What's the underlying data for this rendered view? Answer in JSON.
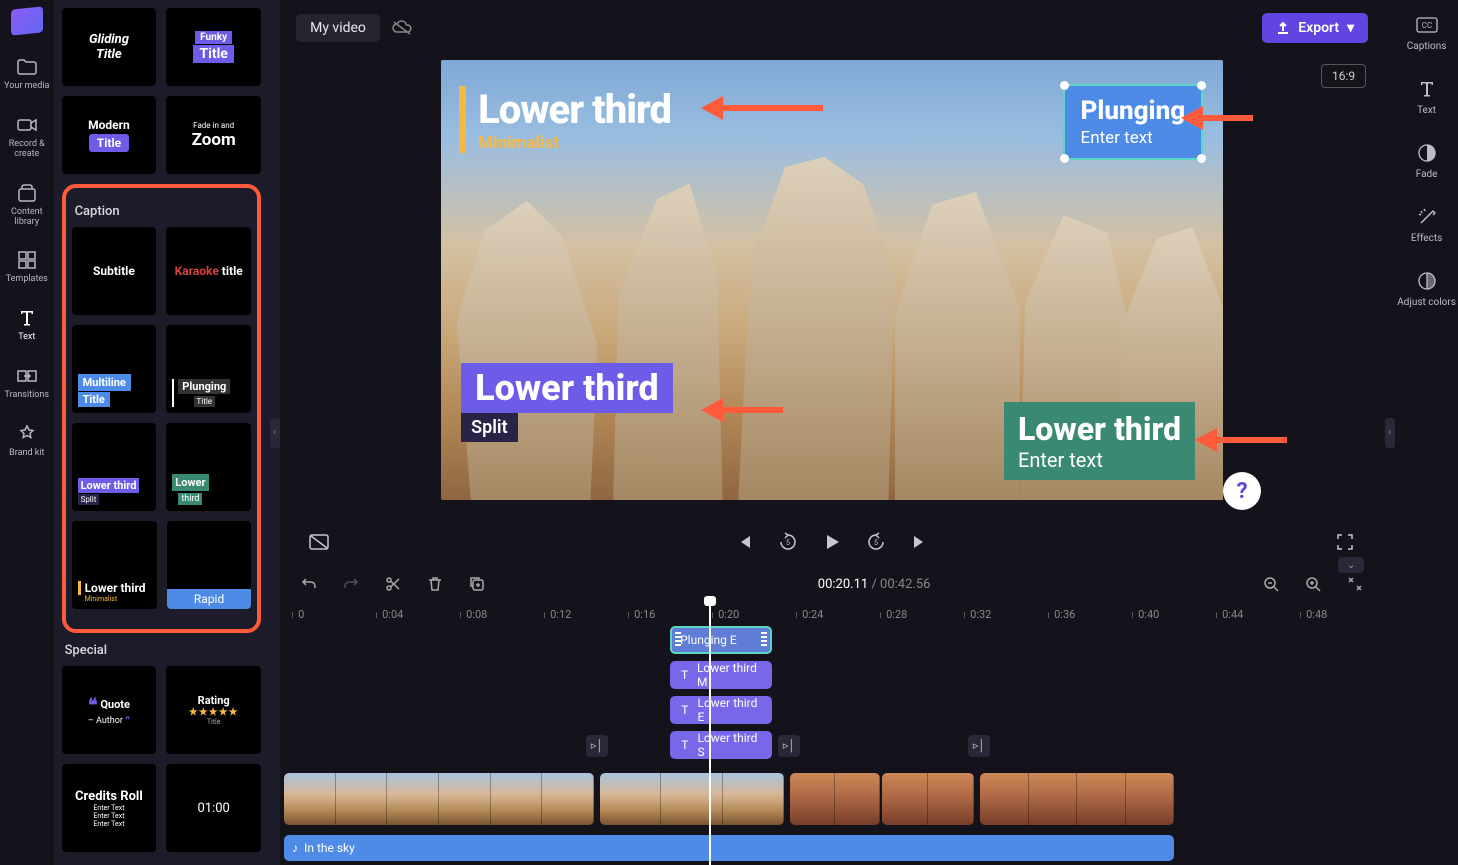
{
  "app": {
    "title": "My video"
  },
  "export": {
    "label": "Export"
  },
  "aspect_ratio": "16:9",
  "far_left_nav": [
    {
      "id": "your-media",
      "label": "Your media",
      "icon": "folder-icon"
    },
    {
      "id": "record-create",
      "label": "Record & create",
      "icon": "camera-icon"
    },
    {
      "id": "content-library",
      "label": "Content library",
      "icon": "library-icon"
    },
    {
      "id": "templates",
      "label": "Templates",
      "icon": "templates-icon"
    },
    {
      "id": "text",
      "label": "Text",
      "icon": "text-icon",
      "active": true
    },
    {
      "id": "transitions",
      "label": "Transitions",
      "icon": "transitions-icon"
    },
    {
      "id": "brand-kit",
      "label": "Brand kit",
      "icon": "brandkit-icon"
    }
  ],
  "text_panel": {
    "top_tiles": [
      {
        "id": "gliding-title",
        "line1": "Gliding",
        "line2": "Title"
      },
      {
        "id": "funky-title",
        "pill": "Funky",
        "main": "Title"
      },
      {
        "id": "modern-title",
        "line1": "Modern",
        "pill": "Title"
      },
      {
        "id": "fade-zoom",
        "line1": "Fade in and",
        "line2": "Zoom"
      }
    ],
    "caption_section": {
      "title": "Caption",
      "tiles": [
        {
          "id": "subtitle",
          "label": "Subtitle"
        },
        {
          "id": "karaoke",
          "colored": "Karaoke",
          "rest": " title"
        },
        {
          "id": "multiline",
          "line1": "Multiline",
          "line2": "Title"
        },
        {
          "id": "plunging",
          "line1": "Plunging",
          "line2": "Title"
        },
        {
          "id": "lt-split",
          "line1": "Lower third",
          "line2": "Split"
        },
        {
          "id": "lt-green",
          "line1": "Lower",
          "line2": "third"
        },
        {
          "id": "lt-minimalist",
          "line1": "Lower third",
          "line2": "Minimalist"
        },
        {
          "id": "rapid",
          "line1": "Rapid"
        }
      ]
    },
    "special_section": {
      "title": "Special",
      "tiles": [
        {
          "id": "quote",
          "line1": "Quote",
          "line2": "– Author"
        },
        {
          "id": "rating",
          "line1": "Rating",
          "sub": "Title"
        },
        {
          "id": "credits",
          "line1": "Credits Roll",
          "sub": "Enter Text"
        },
        {
          "id": "countdown",
          "line1": "01:00"
        }
      ]
    }
  },
  "preview_overlays": {
    "lt_minimalist": {
      "title": "Lower third",
      "subtitle": "Minimalist"
    },
    "plunging": {
      "title": "Plunging",
      "subtitle": "Enter text"
    },
    "lt_split": {
      "title": "Lower third",
      "subtitle": "Split"
    },
    "lt_green": {
      "title": "Lower third",
      "subtitle": "Enter text"
    }
  },
  "playback": {
    "current": "00:20.11",
    "duration": "00:42.56"
  },
  "ruler_ticks": [
    "0",
    "0:04",
    "0:08",
    "0:12",
    "0:16",
    "0:20",
    "0:24",
    "0:28",
    "0:32",
    "0:36",
    "0:40",
    "0:44",
    "0:48"
  ],
  "timeline_clips": {
    "text_tracks": [
      {
        "label": "Plunging E",
        "selected": true
      },
      {
        "label": "Lower third M"
      },
      {
        "label": "Lower third E"
      },
      {
        "label": "Lower third S"
      }
    ],
    "audio": {
      "label": "In the sky"
    }
  },
  "right_panel": [
    {
      "id": "captions",
      "label": "Captions",
      "icon": "cc-icon"
    },
    {
      "id": "text-props",
      "label": "Text",
      "icon": "text-icon"
    },
    {
      "id": "fade",
      "label": "Fade",
      "icon": "fade-icon"
    },
    {
      "id": "effects",
      "label": "Effects",
      "icon": "effects-icon"
    },
    {
      "id": "adjust-colors",
      "label": "Adjust colors",
      "icon": "adjust-icon"
    }
  ]
}
